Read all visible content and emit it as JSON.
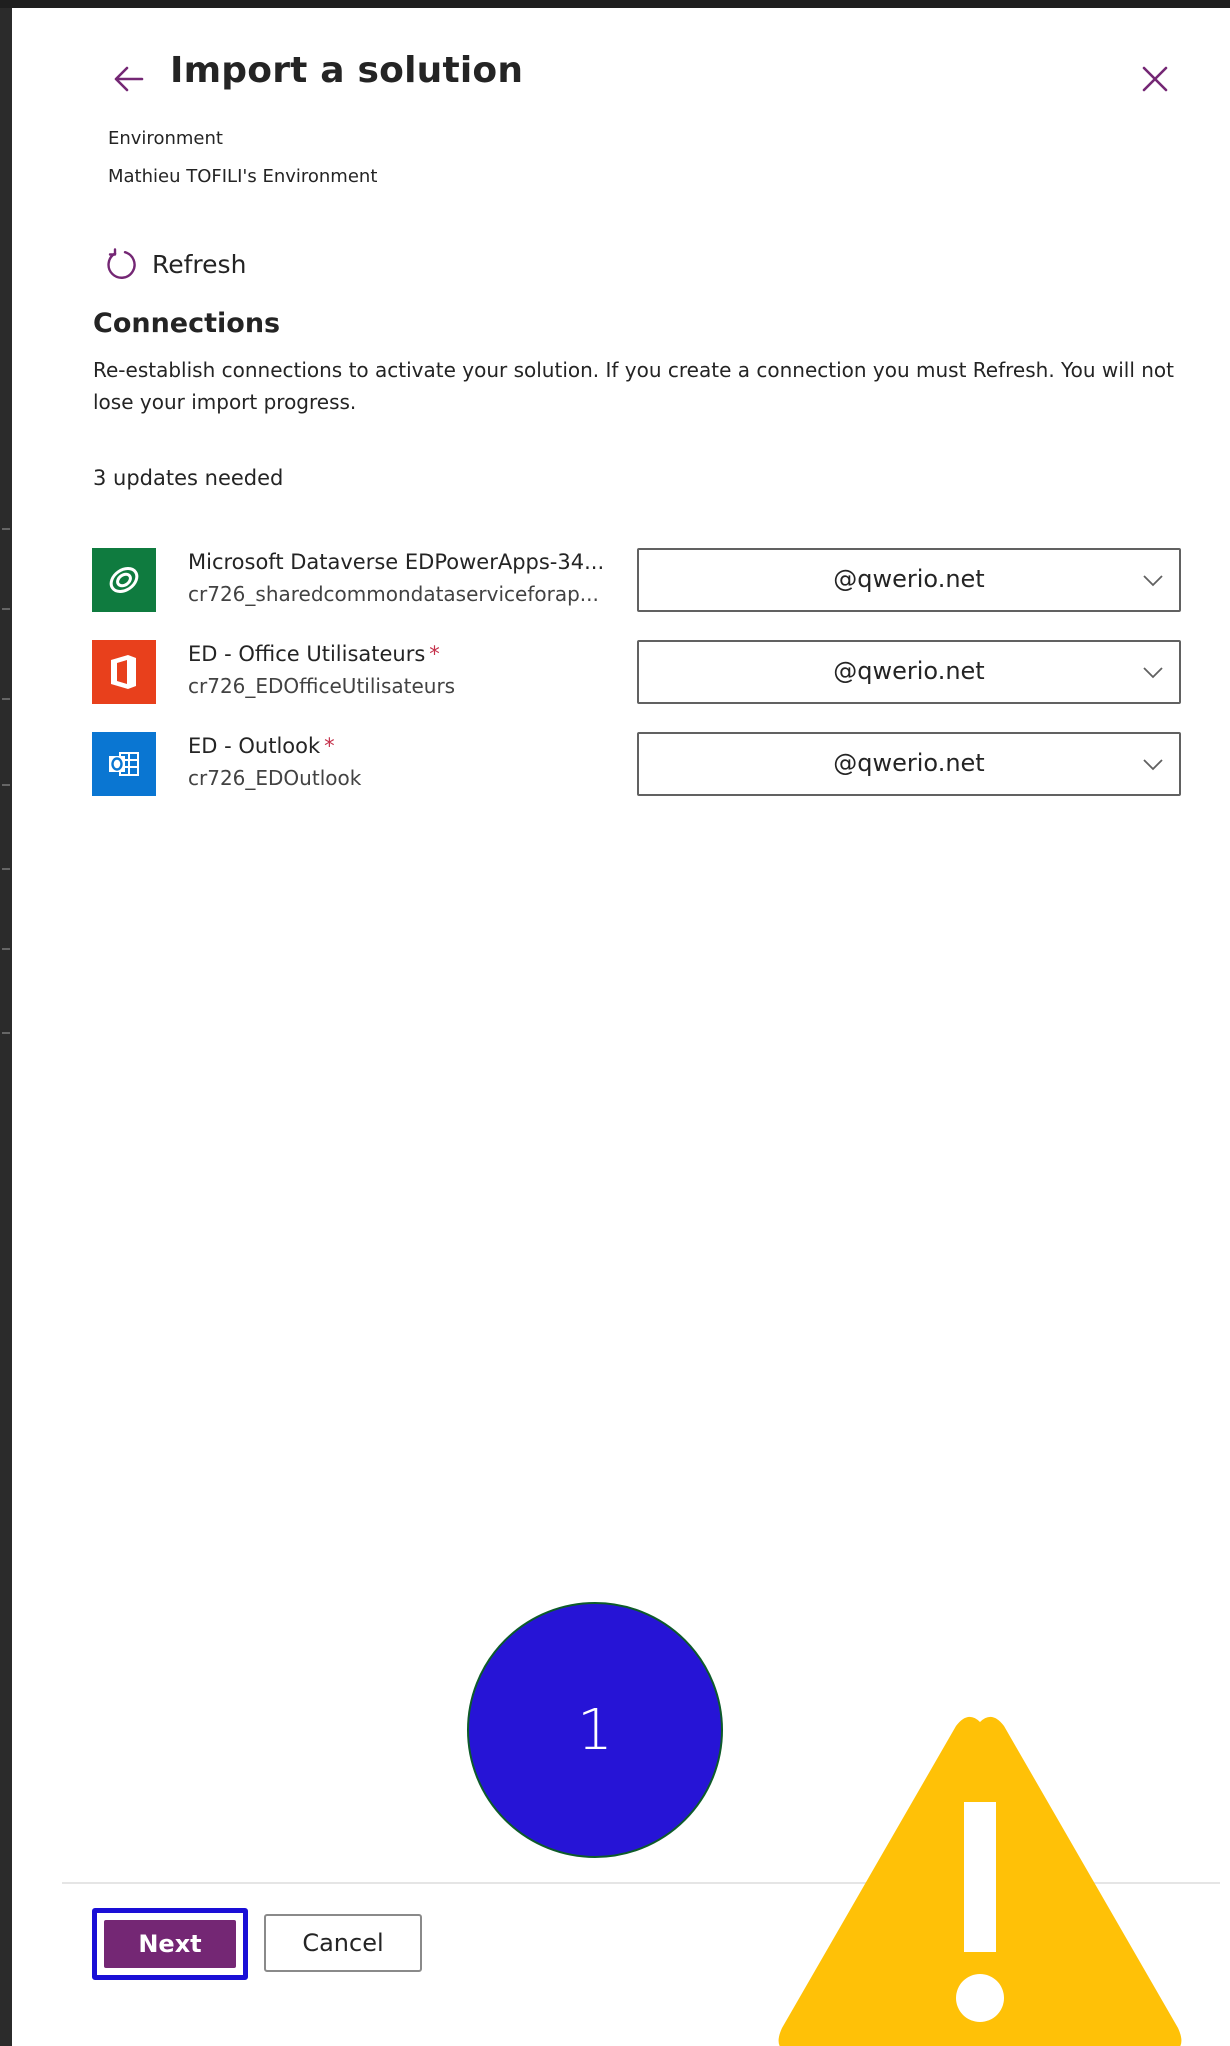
{
  "header": {
    "title": "Import a solution",
    "environment_label": "Environment",
    "environment_value": "Mathieu TOFILI's Environment"
  },
  "toolbar": {
    "refresh_label": "Refresh"
  },
  "connections": {
    "title": "Connections",
    "description": "Re-establish connections to activate your solution. If you create a connection you must Refresh. You will not lose your import progress.",
    "updates_needed": "3 updates needed",
    "items": [
      {
        "name": "Microsoft Dataverse EDPowerApps-34...",
        "id": "cr726_sharedcommondataserviceforap...",
        "required": false,
        "selected": "@qwerio.net",
        "icon": "dataverse-icon"
      },
      {
        "name": "ED - Office Utilisateurs",
        "id": "cr726_EDOfficeUtilisateurs",
        "required": true,
        "required_mark": "*",
        "selected": "@qwerio.net",
        "icon": "office-icon"
      },
      {
        "name": "ED - Outlook",
        "id": "cr726_EDOutlook",
        "required": true,
        "required_mark": "*",
        "selected": "@qwerio.net",
        "icon": "outlook-icon"
      }
    ]
  },
  "footer": {
    "next_label": "Next",
    "cancel_label": "Cancel"
  },
  "annotations": {
    "step_number": "1",
    "warning_icon": "warning-triangle-icon"
  },
  "colors": {
    "accent_purple": "#742774",
    "focus_outline": "#1a0fd6",
    "dataverse_green": "#0f7b3f",
    "office_orange": "#e8401c",
    "outlook_blue": "#0a76d2",
    "required_red": "#c4314b",
    "badge_blue": "#2614d6",
    "warning_yellow": "#ffc107"
  }
}
